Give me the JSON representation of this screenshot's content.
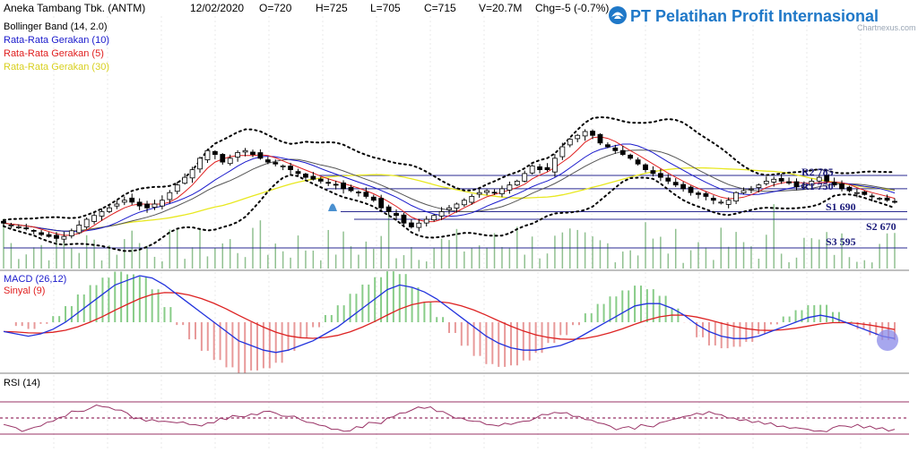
{
  "header": {
    "title": "Aneka Tambang Tbk. (ANTM)",
    "date": "12/02/2020",
    "open": "O=720",
    "high": "H=725",
    "low": "L=705",
    "close": "C=715",
    "volume": "V=20.7M",
    "change": "Chg=-5 (-0.7%)"
  },
  "brand": {
    "name": "PT Pelatihan Profit Internasional",
    "icon": "lotus-icon",
    "color": "#1f78c8"
  },
  "watermark": "Chartnexus.com",
  "colors": {
    "bollinger": "#000000",
    "ma10": "#1a1acc",
    "ma5": "#e02020",
    "ma30": "#e8e820",
    "level": "#2a2a90",
    "volume": "#90c090",
    "macd": "#2233dd",
    "signal": "#dd2222",
    "hist_up": "#88cc88",
    "hist_down": "#e89999",
    "rsi": "#993366"
  },
  "legend": {
    "bollinger": "Bollinger Band (14, 2.0)",
    "ma10": "Rata-Rata Gerakan (10)",
    "ma5": "Rata-Rata Gerakan (5)",
    "ma30": "Rata-Rata Gerakan (30)",
    "macd": "MACD (26,12)",
    "signal": "Sinyal (9)",
    "rsi": "RSI (14)"
  },
  "chart_data": [
    {
      "type": "line",
      "subtype": "candlestick",
      "close_series": [
        660,
        655,
        650,
        645,
        640,
        630,
        625,
        620,
        625,
        640,
        655,
        670,
        680,
        690,
        700,
        710,
        720,
        715,
        705,
        700,
        710,
        720,
        740,
        760,
        780,
        800,
        830,
        850,
        840,
        820,
        830,
        845,
        850,
        840,
        830,
        820,
        815,
        810,
        800,
        790,
        780,
        775,
        770,
        765,
        760,
        750,
        745,
        740,
        730,
        720,
        700,
        690,
        680,
        660,
        650,
        660,
        670,
        680,
        690,
        700,
        710,
        720,
        730,
        740,
        745,
        740,
        750,
        760,
        770,
        790,
        810,
        800,
        800,
        830,
        860,
        880,
        890,
        900,
        890,
        870,
        860,
        850,
        840,
        830,
        815,
        800,
        790,
        780,
        770,
        760,
        750,
        740,
        735,
        730,
        720,
        715,
        720,
        740,
        745,
        750,
        760,
        770,
        775,
        770,
        765,
        755,
        760,
        770,
        780,
        770,
        760,
        750,
        745,
        740,
        735,
        730,
        725,
        720,
        715
      ],
      "levels": [
        {
          "label": "R2 785",
          "value": 785
        },
        {
          "label": "R1 750",
          "value": 750
        },
        {
          "label": "S1 690",
          "value": 690
        },
        {
          "label": "S2 670",
          "value": 670
        },
        {
          "label": "S3 595",
          "value": 595
        }
      ],
      "series": [
        {
          "name": "Bollinger Band (14, 2.0)"
        },
        {
          "name": "Rata-Rata Gerakan (10)"
        },
        {
          "name": "Rata-Rata Gerakan (5)"
        },
        {
          "name": "Rata-Rata Gerakan (30)"
        }
      ],
      "grid": true
    },
    {
      "type": "line",
      "name": "MACD",
      "series": [
        {
          "name": "MACD (26,12)",
          "values": [
            -4,
            -5,
            -6,
            -5,
            -3,
            0,
            4,
            8,
            12,
            16,
            18,
            20,
            19,
            16,
            12,
            8,
            4,
            0,
            -4,
            -8,
            -10,
            -12,
            -13,
            -12,
            -10,
            -8,
            -5,
            -2,
            2,
            6,
            10,
            14,
            16,
            15,
            13,
            10,
            6,
            2,
            -2,
            -6,
            -9,
            -11,
            -12,
            -12,
            -11,
            -10,
            -8,
            -5,
            -2,
            1,
            4,
            7,
            8,
            8,
            6,
            3,
            -1,
            -4,
            -6,
            -7,
            -7,
            -6,
            -4,
            -2,
            0,
            2,
            3,
            2,
            0,
            -2,
            -4,
            -6,
            -7
          ]
        },
        {
          "name": "Sinyal (9)"
        }
      ],
      "grid": true
    },
    {
      "type": "line",
      "name": "RSI",
      "series": [
        {
          "name": "RSI (14)",
          "values": [
            42,
            38,
            36,
            40,
            46,
            52,
            58,
            62,
            64,
            60,
            56,
            50,
            48,
            46,
            44,
            42,
            40,
            44,
            48,
            52,
            55,
            58,
            56,
            52,
            48,
            44,
            40,
            36,
            34,
            38,
            44,
            50,
            56,
            60,
            62,
            58,
            54,
            50,
            46,
            42,
            40,
            42,
            46,
            50,
            54,
            56,
            52,
            48,
            44,
            40,
            38,
            36,
            40,
            44,
            48,
            52,
            56,
            58,
            54,
            50,
            48,
            46,
            44,
            40,
            38,
            36,
            34,
            38,
            40,
            42,
            40,
            38,
            36
          ]
        }
      ],
      "overbought": 70,
      "mid": 50,
      "oversold": 30,
      "grid": true
    }
  ]
}
